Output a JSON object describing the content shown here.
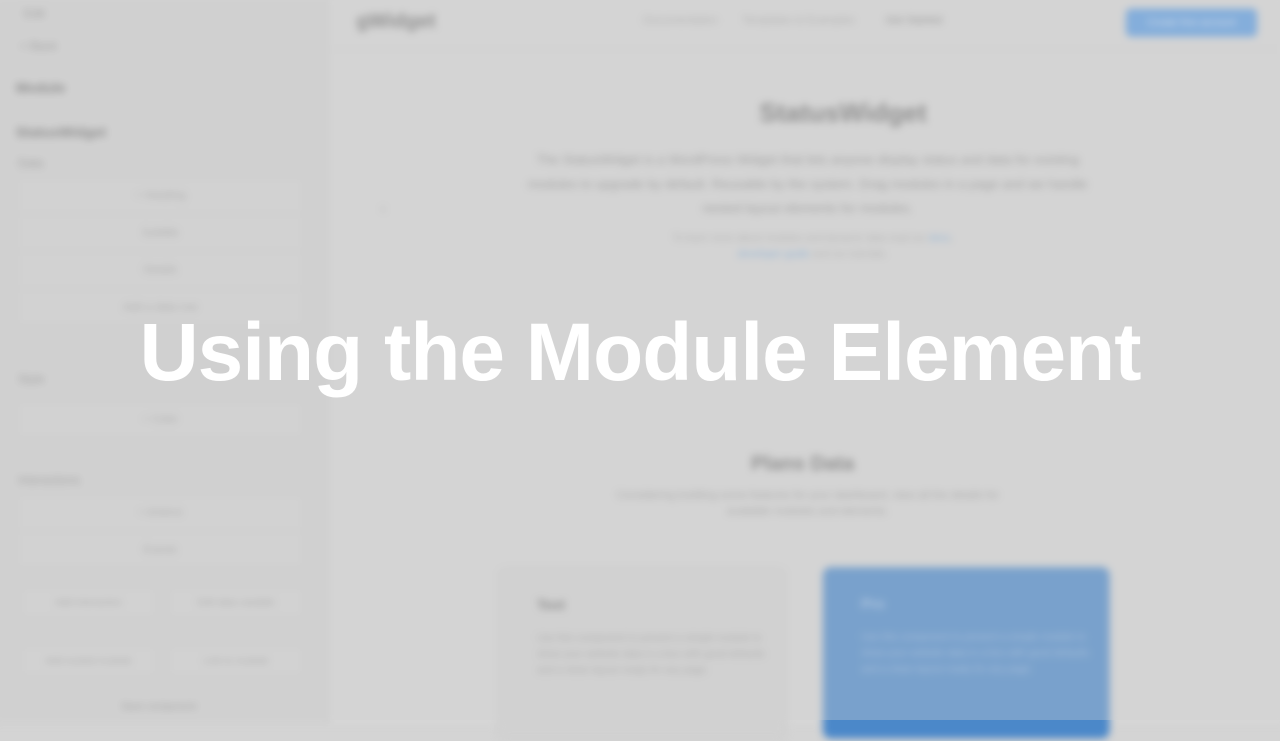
{
  "title": "Using the Module Element",
  "left_panel": {
    "top_items": [
      "Edit",
      "< Back"
    ],
    "panel_label": "Module",
    "module_name": "StatusWidget",
    "group1_label": "Data",
    "group1_rows": [
      "+ Heading",
      "Subtitle",
      "Details",
      "Add a data row"
    ],
    "group2_label": "Style",
    "group2_rows": [
      "+ Color"
    ],
    "group3_label": "Interactions",
    "group3_rows": [
      "+ Actions",
      "Events"
    ],
    "buttons": [
      "Add interaction",
      "Edit data variable",
      "Add nested module",
      "Link to module"
    ],
    "footer": "Save component"
  },
  "canvas": {
    "logo": "gWidget",
    "nav": [
      "Documentation",
      "Templates & Examples",
      "Get Started"
    ],
    "cta": "Create free account",
    "hero_title": "StatusWidget",
    "hero_desc": "The StatusWidget is a WordPress Widget that lets anyone display status and data for existing modules to upgrade by default. Reusable by the system. Drag modules in a page and we handle nested layout elements for modules.",
    "hero_meta_plain": "To learn more about modules and dynamic data read our",
    "hero_meta_links": [
      "docs",
      "developer guide"
    ],
    "hero_meta_tail": "and our tutorials.",
    "section_title": "Plans Data",
    "section_desc": "Considering building some features for your dashboard, view all the details for available modules and elements.",
    "card_plain": {
      "title": "Text",
      "text": "Use this component to present a simple module to show your website data in a box with good defaults and a clean layout ready for any page."
    },
    "card_blue": {
      "title": "Pro",
      "text": "Use this component to present a simple module to show your website data in a box with good defaults and a clean layout ready for any page."
    }
  },
  "colors": {
    "accent": "#4b88c9",
    "title_text": "#ffffff"
  }
}
